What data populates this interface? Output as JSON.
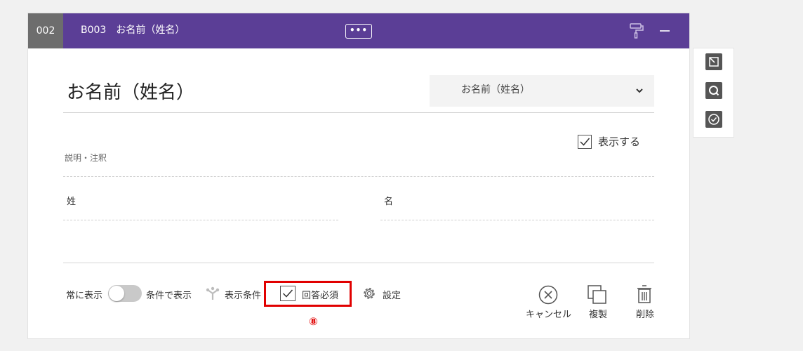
{
  "header": {
    "number": "002",
    "title": "B003　お名前（姓名）",
    "more_label": "•••",
    "brush_icon": "paint-roller-icon",
    "minimize_icon": "minimize-icon",
    "colors": {
      "bar": "#5b3e96",
      "number_bg": "#6d6d6d"
    }
  },
  "question": {
    "title": "お名前（姓名）",
    "type_select": {
      "value": "お名前（姓名）",
      "icon": "chevron-down-icon"
    },
    "display_checkbox": {
      "label": "表示する",
      "checked": true
    },
    "description_placeholder": "説明・注釈",
    "fields": {
      "last_name": "姓",
      "first_name": "名"
    }
  },
  "footer": {
    "always_show": "常に表示",
    "toggle_on": false,
    "conditional_show": "条件で表示",
    "display_condition": "表示条件",
    "required": {
      "label": "回答必須",
      "checked": true
    },
    "settings": "設定",
    "cancel": "キャンセル",
    "duplicate": "複製",
    "delete": "削除",
    "highlight_color": "#e10000",
    "callout_marker": "⑧"
  },
  "side_toolbar": {
    "icons": [
      "edit-box-icon",
      "search-icon",
      "check-circle-icon"
    ]
  }
}
